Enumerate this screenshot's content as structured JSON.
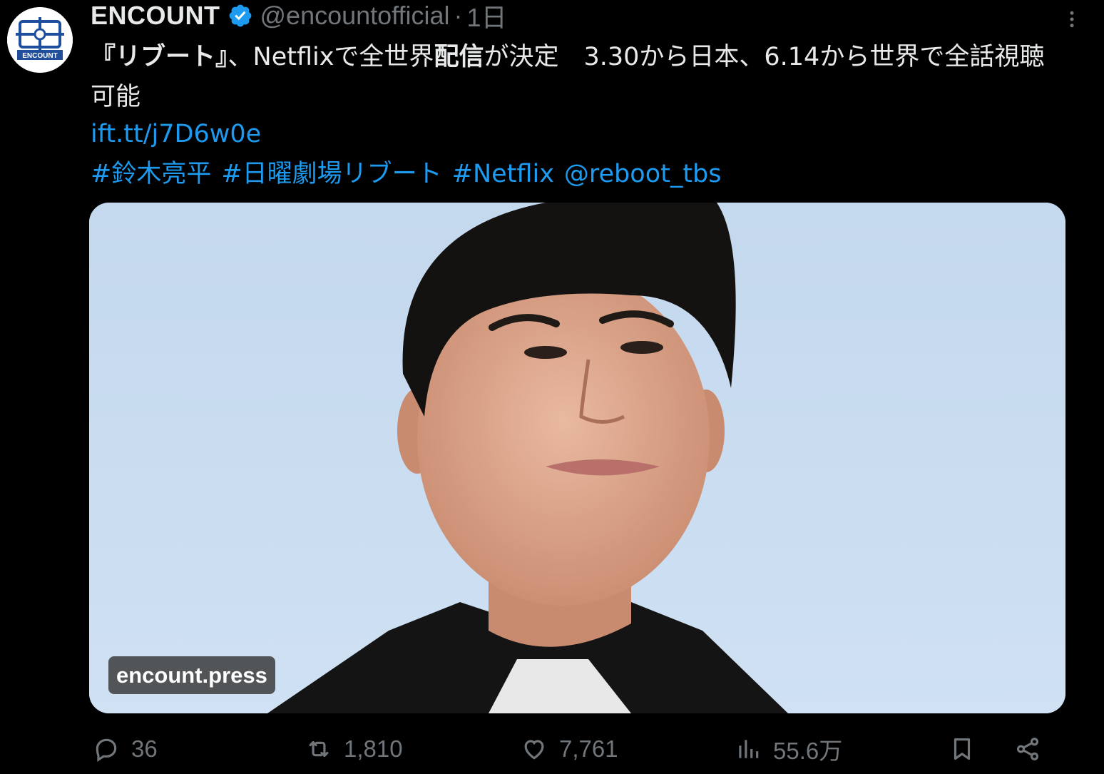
{
  "tweet": {
    "author": {
      "display_name": "ENCOUNT",
      "handle": "@encountofficial",
      "separator": "·",
      "time": "1日",
      "avatar_text": "ENCOUNT"
    },
    "text": {
      "part1_bold": "『リブート』",
      "part2": "、Netflixで全世界",
      "part3_bold": "配信",
      "part4": "が決定　3.30から日本、6.14から世界で全話視聴可能"
    },
    "link": "ift.tt/j7D6w0e",
    "tags": [
      "#鈴木亮平",
      "#日曜劇場リブート",
      "#Netflix",
      "@reboot_tbs"
    ],
    "media": {
      "source_badge": "encount.press"
    },
    "stats": {
      "replies": "36",
      "reposts": "1,810",
      "likes": "7,761",
      "views": "55.6万"
    }
  },
  "colors": {
    "background": "#000000",
    "text": "#e7e9ea",
    "muted": "#71767b",
    "link": "#1d9bf0",
    "verified": "#1d9bf0"
  }
}
